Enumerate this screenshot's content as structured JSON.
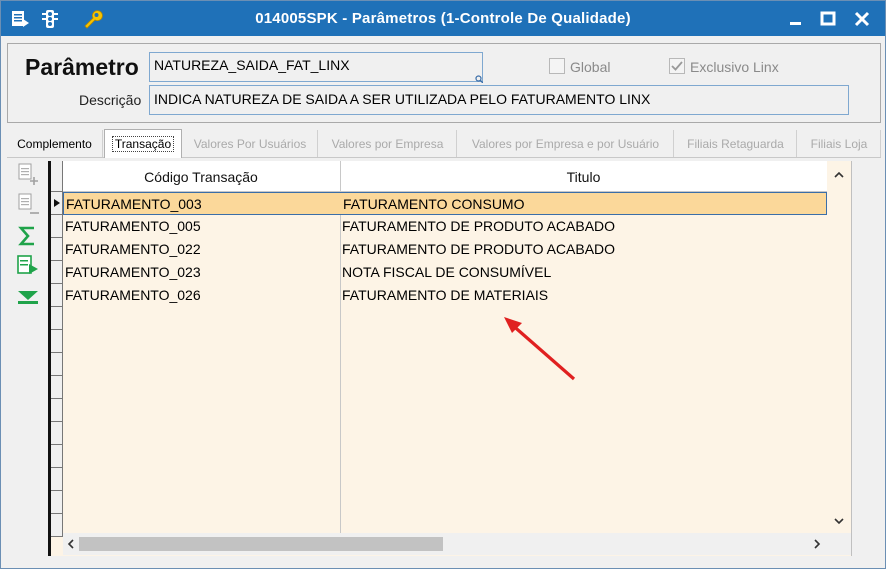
{
  "window": {
    "title": "014005SPK - Parâmetros (1-Controle De Qualidade)",
    "icons": [
      "menu-list-icon",
      "traffic-light-icon",
      "wrench-icon"
    ],
    "controls": [
      "minimize-icon",
      "maximize-icon",
      "close-icon"
    ]
  },
  "header": {
    "param_label": "Parâmetro",
    "param_value": "NATUREZA_SAIDA_FAT_LINX",
    "global_label": "Global",
    "global_checked": false,
    "exclusivo_label": "Exclusivo Linx",
    "exclusivo_checked": true,
    "desc_label": "Descrição",
    "desc_value": "INDICA NATUREZA DE SAIDA A SER UTILIZADA PELO FATURAMENTO LINX"
  },
  "tabs": [
    {
      "label": "Complemento",
      "state": "enabled"
    },
    {
      "label": "Transação",
      "state": "active"
    },
    {
      "label": "Valores Por Usuários",
      "state": "disabled"
    },
    {
      "label": "Valores por Empresa",
      "state": "disabled"
    },
    {
      "label": "Valores por Empresa e por Usuário",
      "state": "disabled"
    },
    {
      "label": "Filiais Retaguarda",
      "state": "disabled"
    },
    {
      "label": "Filiais Loja",
      "state": "disabled"
    }
  ],
  "toolbar_icons": [
    "add-row-icon",
    "remove-row-icon",
    "sum-icon",
    "export-icon",
    "filter-down-icon"
  ],
  "grid": {
    "columns": [
      "Código Transação",
      "Titulo"
    ],
    "rows": [
      {
        "code": "FATURAMENTO_003",
        "title": "FATURAMENTO CONSUMO"
      },
      {
        "code": "FATURAMENTO_005",
        "title": "FATURAMENTO DE PRODUTO ACABADO"
      },
      {
        "code": "FATURAMENTO_022",
        "title": "FATURAMENTO DE PRODUTO ACABADO"
      },
      {
        "code": "FATURAMENTO_023",
        "title": "NOTA FISCAL DE CONSUMÍVEL"
      },
      {
        "code": "FATURAMENTO_026",
        "title": "FATURAMENTO DE MATERIAIS"
      }
    ],
    "selected_row": 0
  },
  "colors": {
    "titlebar": "#1f71b8",
    "grid_bg": "#fdf4e6",
    "selected_row": "#fbd89a",
    "annotation": "#e02020"
  }
}
